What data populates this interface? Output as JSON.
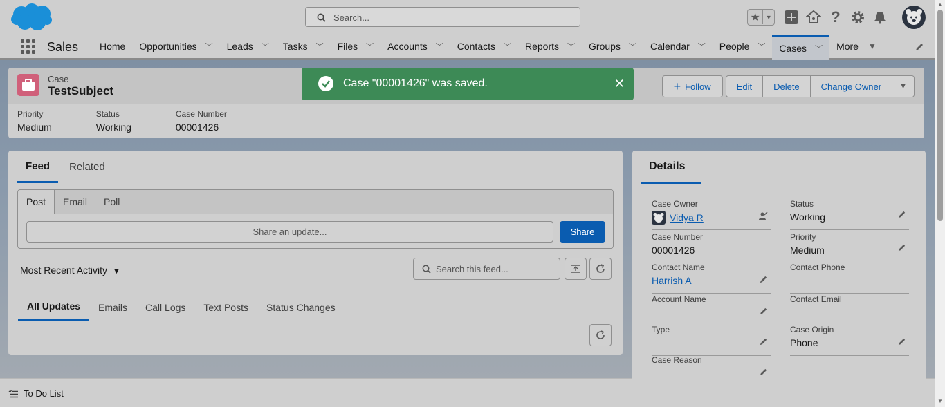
{
  "header": {
    "search_placeholder": "Search..."
  },
  "nav": {
    "app_name": "Sales",
    "items": [
      {
        "label": "Home",
        "has_menu": false
      },
      {
        "label": "Opportunities",
        "has_menu": true
      },
      {
        "label": "Leads",
        "has_menu": true
      },
      {
        "label": "Tasks",
        "has_menu": true
      },
      {
        "label": "Files",
        "has_menu": true
      },
      {
        "label": "Accounts",
        "has_menu": true
      },
      {
        "label": "Contacts",
        "has_menu": true
      },
      {
        "label": "Reports",
        "has_menu": true
      },
      {
        "label": "Groups",
        "has_menu": true
      },
      {
        "label": "Calendar",
        "has_menu": true
      },
      {
        "label": "People",
        "has_menu": true
      },
      {
        "label": "Cases",
        "has_menu": true,
        "active": true
      },
      {
        "label": "More",
        "has_menu": true
      }
    ]
  },
  "record": {
    "object_label": "Case",
    "title": "TestSubject",
    "highlights": [
      {
        "label": "Priority",
        "value": "Medium"
      },
      {
        "label": "Status",
        "value": "Working"
      },
      {
        "label": "Case Number",
        "value": "00001426"
      }
    ],
    "actions": {
      "follow": "Follow",
      "edit": "Edit",
      "delete": "Delete",
      "change_owner": "Change Owner"
    }
  },
  "toast": {
    "message": "Case \"00001426\" was saved.",
    "color": "#3d8a56"
  },
  "feed": {
    "tabs": [
      "Feed",
      "Related"
    ],
    "publisher_tabs": [
      "Post",
      "Email",
      "Poll"
    ],
    "share_placeholder": "Share an update...",
    "share_button": "Share",
    "sort_label": "Most Recent Activity",
    "search_placeholder": "Search this feed...",
    "filter_tabs": [
      "All Updates",
      "Emails",
      "Call Logs",
      "Text Posts",
      "Status Changes"
    ]
  },
  "details": {
    "tab": "Details",
    "left": [
      {
        "label": "Case Owner",
        "value": "Vidya R",
        "link": true
      },
      {
        "label": "Case Number",
        "value": "00001426"
      },
      {
        "label": "Contact Name",
        "value": "Harrish A",
        "link": true
      },
      {
        "label": "Account Name",
        "value": ""
      },
      {
        "label": "Type",
        "value": ""
      },
      {
        "label": "Case Reason",
        "value": ""
      }
    ],
    "right": [
      {
        "label": "Status",
        "value": "Working"
      },
      {
        "label": "Priority",
        "value": "Medium"
      },
      {
        "label": "Contact Phone",
        "value": ""
      },
      {
        "label": "Contact Email",
        "value": ""
      },
      {
        "label": "Case Origin",
        "value": "Phone"
      }
    ]
  },
  "utility": {
    "todo_label": "To Do List"
  },
  "colors": {
    "brand_blue": "#0a5cb0",
    "case_icon": "#d0607a",
    "salesforce_cloud": "#1a8fd8"
  }
}
